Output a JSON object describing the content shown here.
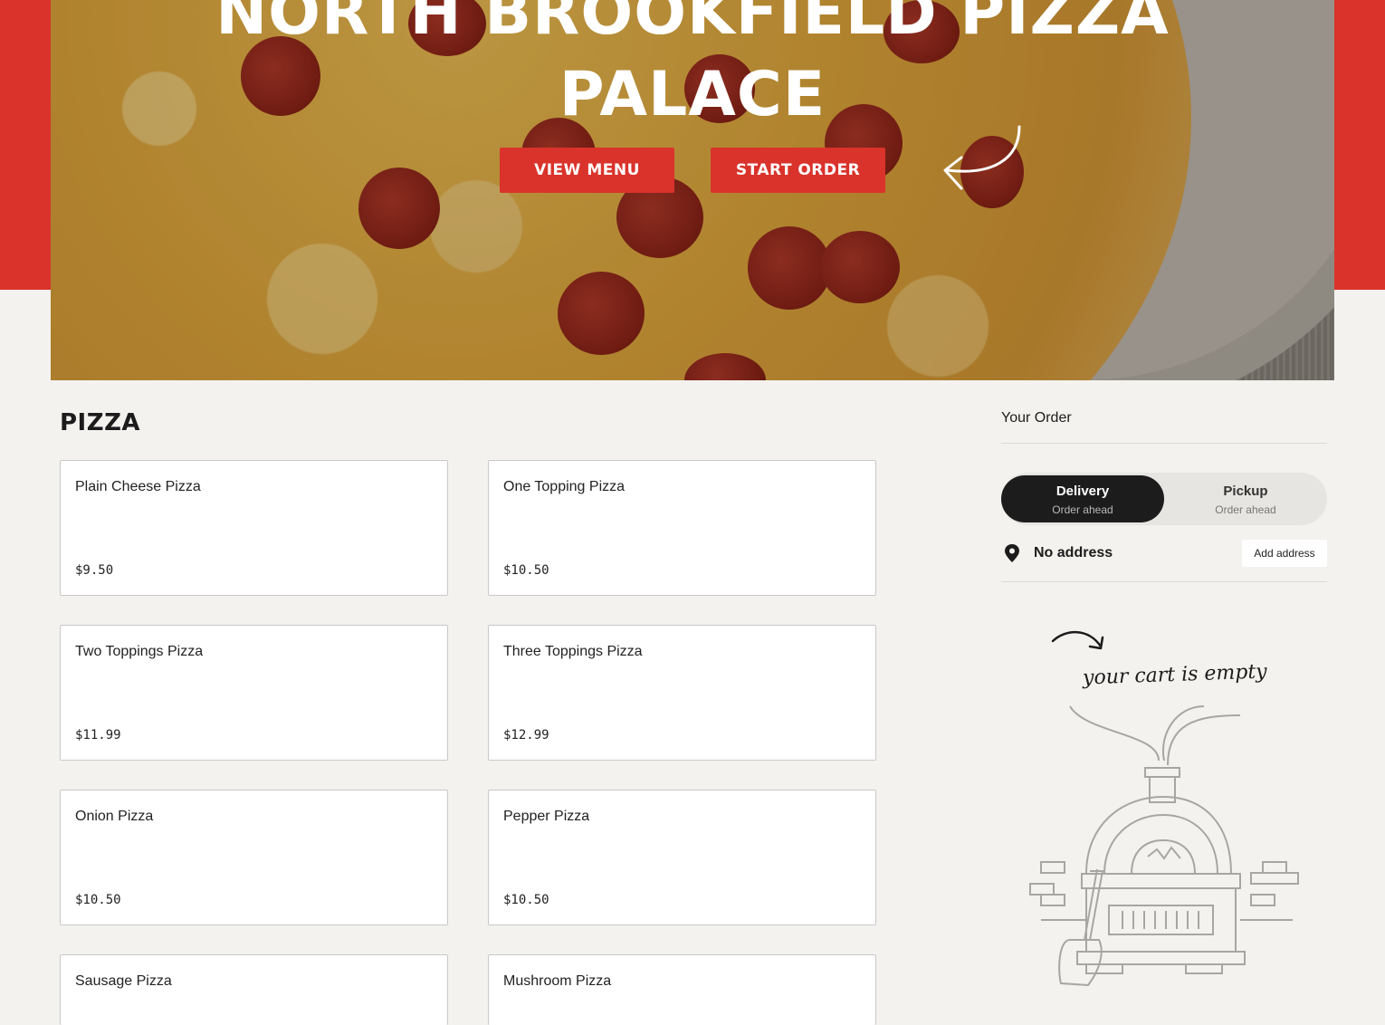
{
  "hero": {
    "title_line1": "NORTH BROOKFIELD PIZZA",
    "title_line2": "PALACE",
    "view_menu_label": "VIEW MENU",
    "start_order_label": "START ORDER"
  },
  "menu": {
    "section_title": "PIZZA",
    "items": [
      {
        "name": "Plain Cheese Pizza",
        "price": "$9.50"
      },
      {
        "name": "One Topping Pizza",
        "price": "$10.50"
      },
      {
        "name": "Two Toppings Pizza",
        "price": "$11.99"
      },
      {
        "name": "Three Toppings Pizza",
        "price": "$12.99"
      },
      {
        "name": "Onion Pizza",
        "price": "$10.50"
      },
      {
        "name": "Pepper Pizza",
        "price": "$10.50"
      },
      {
        "name": "Sausage Pizza",
        "price": ""
      },
      {
        "name": "Mushroom Pizza",
        "price": ""
      }
    ]
  },
  "order": {
    "title": "Your Order",
    "modes": [
      {
        "label": "Delivery",
        "sublabel": "Order ahead",
        "selected": true
      },
      {
        "label": "Pickup",
        "sublabel": "Order ahead",
        "selected": false
      }
    ],
    "address_text": "No address",
    "add_address_label": "Add address",
    "empty_cart_text": "your cart is empty"
  },
  "colors": {
    "brand_red": "#d9332b",
    "dark": "#1c1c1c",
    "panel_bg": "#f3f2ef"
  },
  "icons": {
    "address": "map-pin-icon",
    "hero_arrow": "curved-arrow-icon",
    "cart_arrow": "curved-arrow-icon",
    "illustration": "pizza-oven-illustration"
  }
}
